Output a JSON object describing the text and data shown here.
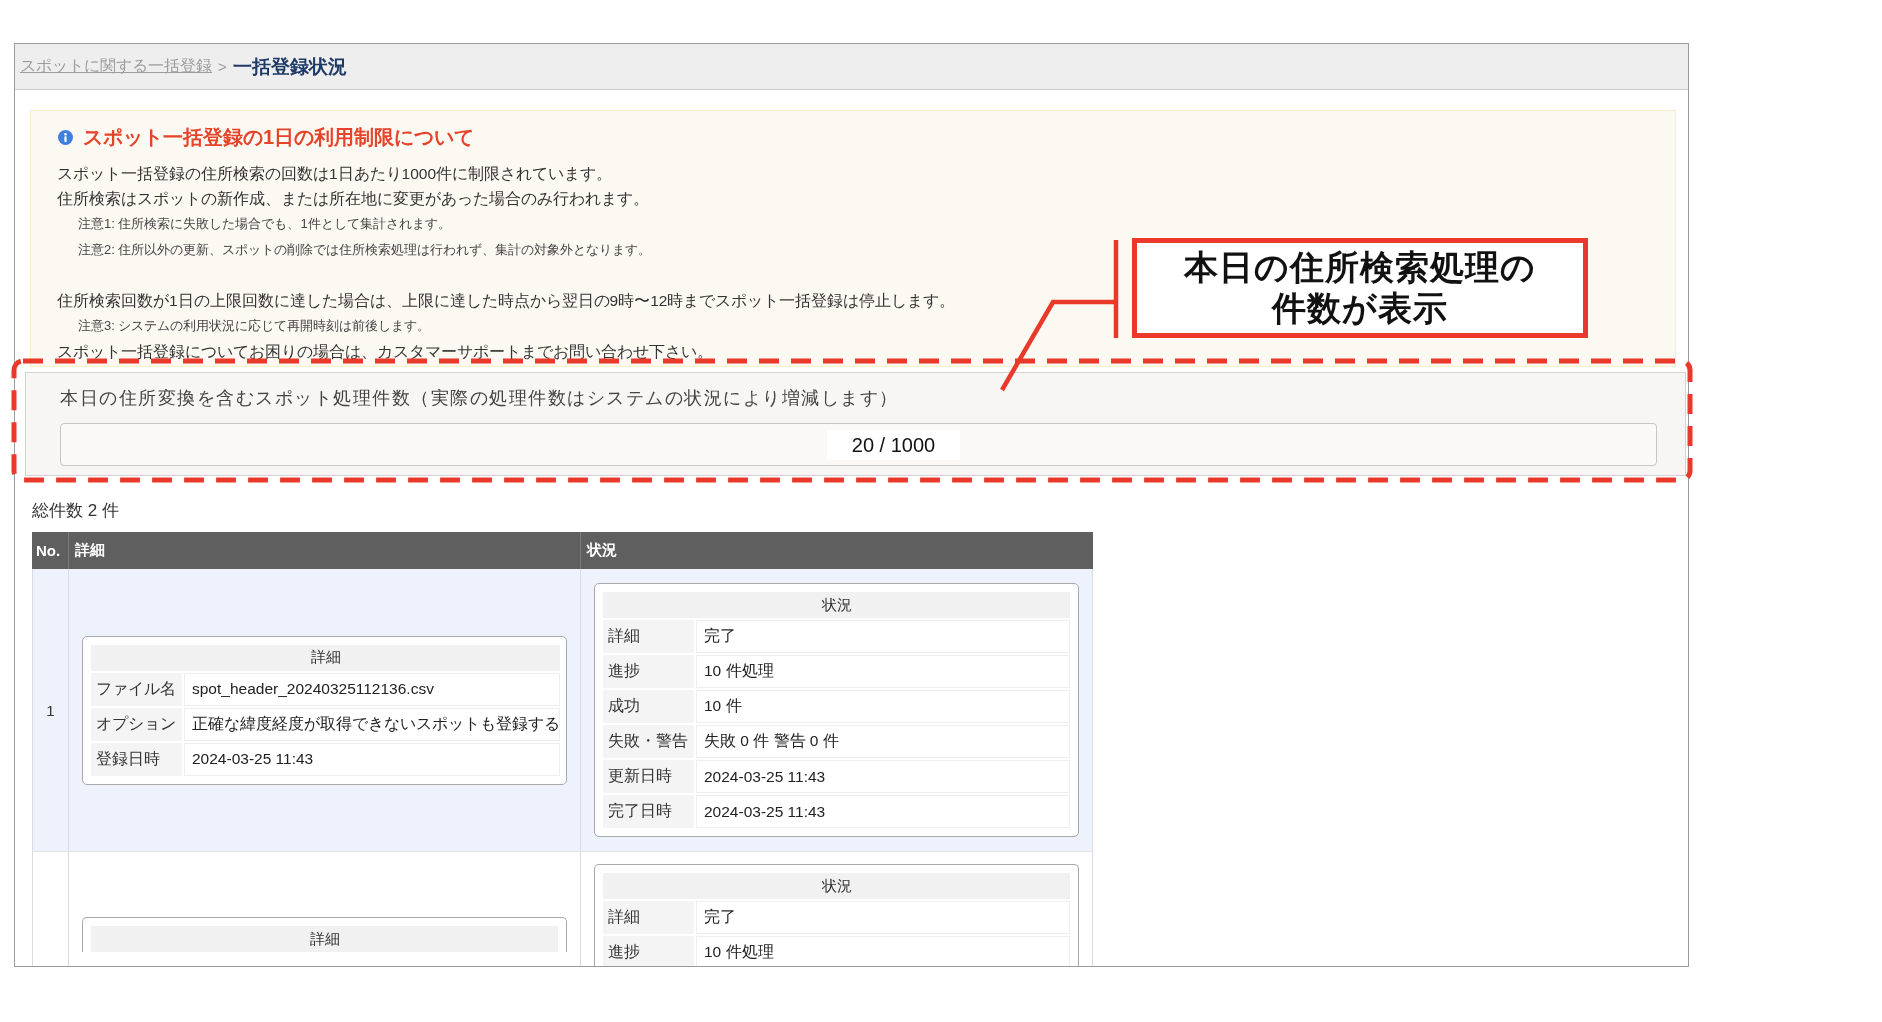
{
  "breadcrumb": {
    "items": [
      {
        "kind": "link",
        "label": "スポットに関する一括登録"
      },
      {
        "kind": "separator",
        "label": ">"
      },
      {
        "kind": "current",
        "label": "一括登録状況"
      }
    ]
  },
  "notice": {
    "title": "スポット一括登録の1日の利用制限について",
    "paragraphs": [
      {
        "lines": [
          {
            "kind": "text",
            "text": "スポット一括登録の住所検索の回数は1日あたり1000件に制限されています。"
          },
          {
            "kind": "text",
            "text": "住所検索はスポットの新作成、または所在地に変更があった場合のみ行われます。"
          },
          {
            "kind": "note",
            "text": "注意1: 住所検索に失敗した場合でも、1件として集計されます。"
          },
          {
            "kind": "note",
            "text": "注意2: 住所以外の更新、スポットの削除では住所検索処理は行われず、集計の対象外となります。"
          }
        ]
      },
      {
        "lines": [
          {
            "kind": "text",
            "text": "住所検索回数が1日の上限回数に達した場合は、上限に達した時点から翌日の9時〜12時までスポット一括登録は停止します。"
          },
          {
            "kind": "note",
            "text": "注意3: システムの利用状況に応じて再開時刻は前後します。"
          },
          {
            "kind": "text",
            "text": "スポット一括登録についてお困りの場合は、カスタマーサポートまでお問い合わせ下さい。"
          }
        ]
      }
    ]
  },
  "usage": {
    "label": "本日の住所変換を含むスポット処理件数（実際の処理件数はシステムの状況により増減します）",
    "reading": "20 / 1000"
  },
  "total": "総件数 2 件",
  "table": {
    "columns": [
      "No.",
      "詳細",
      "状況"
    ],
    "rows": [
      {
        "no": "1",
        "detail": {
          "title": "詳細",
          "fields": [
            {
              "label": "ファイル名",
              "value": "spot_header_20240325112136.csv"
            },
            {
              "label": "オプション",
              "value": "正確な緯度経度が取得できないスポットも登録する"
            },
            {
              "label": "登録日時",
              "value": "2024-03-25 11:43"
            }
          ]
        },
        "status": {
          "title": "状況",
          "fields": [
            {
              "label": "詳細",
              "value": "完了"
            },
            {
              "label": "進捗",
              "value": "10 件処理"
            },
            {
              "label": "成功",
              "value": "10 件"
            },
            {
              "label": "失敗・警告",
              "value": "失敗 0 件 警告 0 件"
            },
            {
              "label": "更新日時",
              "value": "2024-03-25 11:43"
            },
            {
              "label": "完了日時",
              "value": "2024-03-25 11:43"
            }
          ]
        }
      },
      {
        "detail": {
          "title": "詳細"
        },
        "status": {
          "title": "状況",
          "fields": [
            {
              "label": "詳細",
              "value": "完了"
            },
            {
              "label": "進捗",
              "value": "10 件処理"
            }
          ]
        }
      }
    ]
  },
  "callout": {
    "lines": [
      "本日の住所検索処理の",
      "件数が表示"
    ]
  }
}
